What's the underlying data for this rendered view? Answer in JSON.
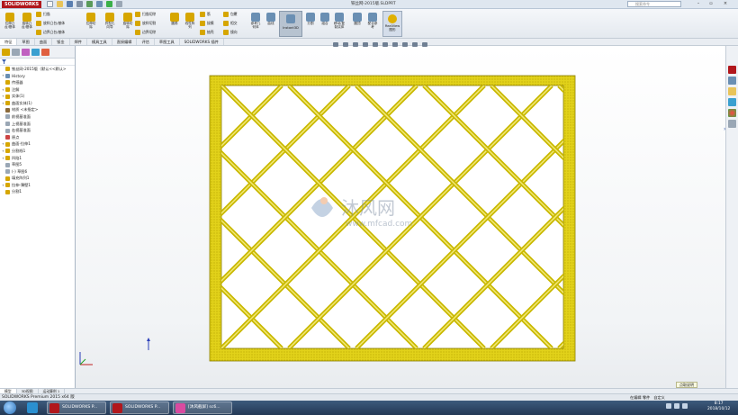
{
  "app": {
    "logo_text": "SOLIDWORKS",
    "doc_title": "铁丝网-2015版.SLDPRT",
    "search_placeholder": "搜索命令",
    "brand_color": "#b1171c"
  },
  "ribbon": {
    "big_buttons": [
      {
        "label": "拉伸凸\n台/基体",
        "icon": "extrude-boss-icon",
        "color": "#d6a600"
      },
      {
        "label": "旋转凸\n台/基体",
        "icon": "revolve-boss-icon",
        "color": "#d6a600"
      },
      {
        "label": "拉伸切\n除",
        "icon": "extrude-cut-icon",
        "color": "#d6a600"
      },
      {
        "label": "异型孔\n向导",
        "icon": "hole-wizard-icon",
        "color": "#d6a600"
      },
      {
        "label": "旋转切\n除",
        "icon": "revolve-cut-icon",
        "color": "#d6a600"
      },
      {
        "label": "圆角",
        "icon": "fillet-icon",
        "color": "#d6a600"
      },
      {
        "label": "线性阵\n列",
        "icon": "linear-pattern-icon",
        "color": "#d6a600"
      },
      {
        "label": "参考几\n何体",
        "icon": "reference-geometry-icon",
        "color": "#6a8fb3"
      },
      {
        "label": "曲线",
        "icon": "curves-icon",
        "color": "#6a8fb3"
      },
      {
        "label": "分割",
        "icon": "split-icon",
        "color": "#6a8fb3"
      },
      {
        "label": "组合",
        "icon": "combine-icon",
        "color": "#6a8fb3"
      },
      {
        "label": "移动/复\n制实体",
        "icon": "move-copy-icon",
        "color": "#6a8fb3"
      },
      {
        "label": "圆顶",
        "icon": "dome-icon",
        "color": "#6a8fb3"
      },
      {
        "label": "配合参\n考",
        "icon": "mate-reference-icon",
        "color": "#6a8fb3"
      }
    ],
    "small_buttons": [
      {
        "label": "扫描",
        "icon": "sweep-icon"
      },
      {
        "label": "放样凸台/基体",
        "icon": "loft-icon"
      },
      {
        "label": "边界凸台/基体",
        "icon": "boundary-icon"
      },
      {
        "label": "扫描切除",
        "icon": "swept-cut-icon"
      },
      {
        "label": "放样切割",
        "icon": "lofted-cut-icon"
      },
      {
        "label": "边界切除",
        "icon": "boundary-cut-icon"
      },
      {
        "label": "筋",
        "icon": "rib-icon"
      },
      {
        "label": "拔模",
        "icon": "draft-icon"
      },
      {
        "label": "抽壳",
        "icon": "shell-icon"
      },
      {
        "label": "包覆",
        "icon": "wrap-icon"
      },
      {
        "label": "相交",
        "icon": "intersect-icon"
      },
      {
        "label": "镜向",
        "icon": "mirror-icon"
      }
    ],
    "instant3d_label": "Instant3D",
    "realview_label": "RealView\n图形"
  },
  "cm_tabs": [
    "特征",
    "草图",
    "曲面",
    "钣金",
    "焊件",
    "模具工具",
    "直接编辑",
    "评估",
    "草图工具",
    "SOLIDWORKS 插件"
  ],
  "cm_active_index": 0,
  "tree": [
    {
      "label": "铁丝网-2015版（默认<<默认>",
      "icon_color": "#d6a600",
      "exp": ""
    },
    {
      "label": "History",
      "icon_color": "#6a8fb3",
      "exp": "+"
    },
    {
      "label": "传感器",
      "icon_color": "#d6a600",
      "exp": ""
    },
    {
      "label": "注解",
      "icon_color": "#d6a600",
      "exp": "+"
    },
    {
      "label": "实体(1)",
      "icon_color": "#d6a600",
      "exp": "+"
    },
    {
      "label": "曲面实体(1)",
      "icon_color": "#d6a600",
      "exp": "+"
    },
    {
      "label": "材质 <未指定>",
      "icon_color": "#8b6a3a",
      "exp": ""
    },
    {
      "label": "前视基准面",
      "icon_color": "#9aa7b5",
      "exp": ""
    },
    {
      "label": "上视基准面",
      "icon_color": "#9aa7b5",
      "exp": ""
    },
    {
      "label": "右视基准面",
      "icon_color": "#9aa7b5",
      "exp": ""
    },
    {
      "label": "原点",
      "icon_color": "#c44",
      "exp": ""
    },
    {
      "label": "曲面-拉伸1",
      "icon_color": "#d6a600",
      "exp": "+"
    },
    {
      "label": "分割线1",
      "icon_color": "#d6a600",
      "exp": "+"
    },
    {
      "label": "凹陷1",
      "icon_color": "#d6a600",
      "exp": "+"
    },
    {
      "label": "草图5",
      "icon_color": "#9aa7b5",
      "exp": ""
    },
    {
      "label": "(-) 草图6",
      "icon_color": "#9aa7b5",
      "exp": ""
    },
    {
      "label": "填充阵列1",
      "icon_color": "#d6a600",
      "exp": ""
    },
    {
      "label": "拉伸-薄壁1",
      "icon_color": "#d6a600",
      "exp": "+"
    },
    {
      "label": "分割1",
      "icon_color": "#d6a600",
      "exp": ""
    }
  ],
  "sheet_tabs": [
    "模型",
    "3D视图",
    "运动算例 1"
  ],
  "status": {
    "left": "SOLIDWORKS Premium 2015 x64 版",
    "editing": "在编辑 零件",
    "units": "自定义",
    "tip": "点取说明"
  },
  "taskbar": {
    "buttons": [
      {
        "label": "SOLIDWORKS P...",
        "icon_color": "#b1171c"
      },
      {
        "label": "SOLIDWORKS P...",
        "icon_color": "#b1171c"
      },
      {
        "label": "[沐风截屏] sc6...",
        "icon_color": "#d94aa0"
      }
    ],
    "time": "8:17",
    "date": "2018/10/12"
  },
  "watermark": {
    "brand": "沐风网",
    "url": "www.mfcad.com"
  },
  "model": {
    "frame_color": "#e0d018",
    "wire_color": "#c9b800"
  }
}
